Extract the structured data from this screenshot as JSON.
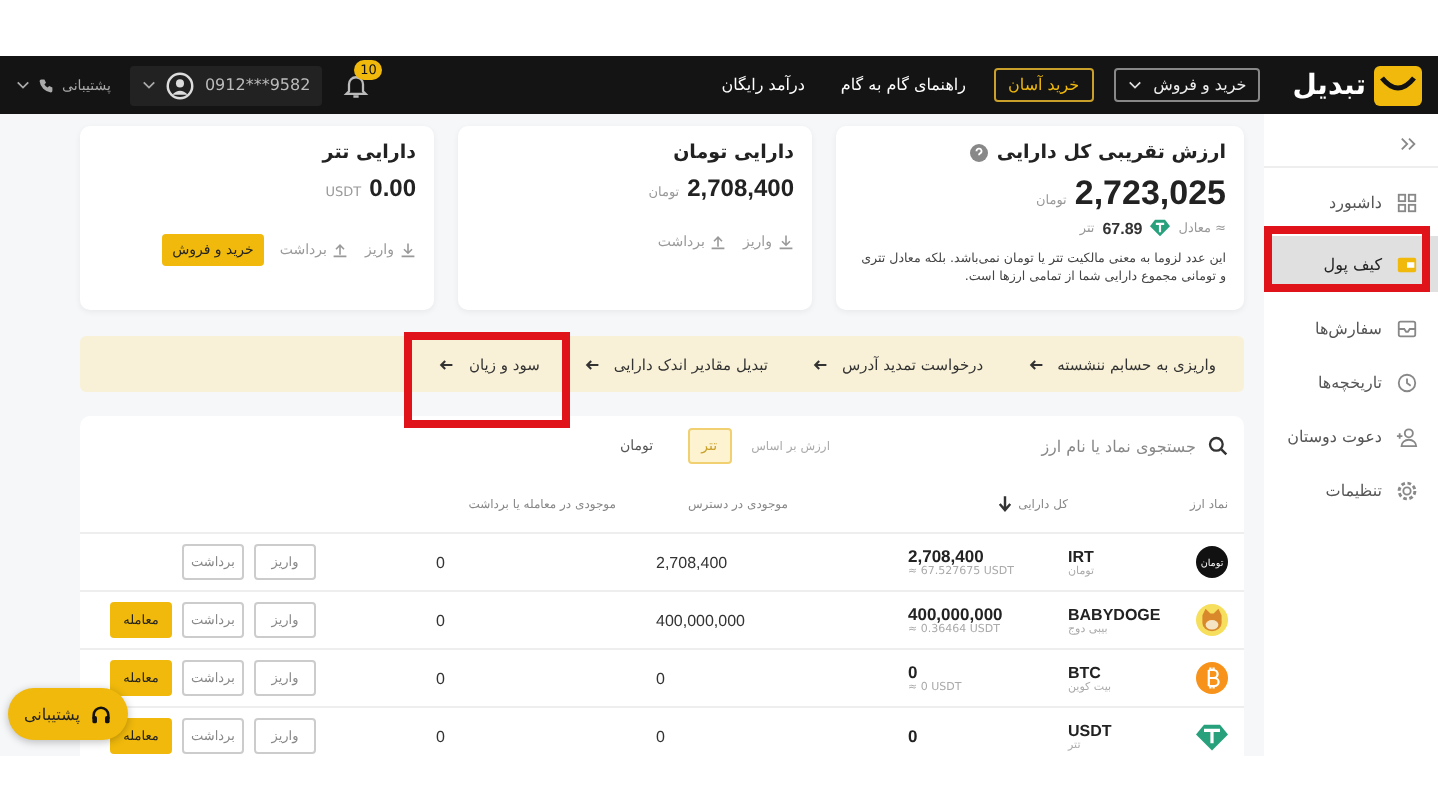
{
  "header": {
    "logo": "تبدیل",
    "nav": [
      {
        "label": "خرید و فروش",
        "kind": "dropdown"
      },
      {
        "label": "خرید آسان",
        "kind": "outlined"
      },
      {
        "label": "راهنمای گام به گام",
        "kind": "link"
      },
      {
        "label": "درآمد رایگان",
        "kind": "link"
      }
    ],
    "notifications": "10",
    "phone": "0912***9582",
    "support": "پشتیبانی"
  },
  "sidebar": {
    "items": [
      {
        "label": "داشبورد",
        "selected": false
      },
      {
        "label": "کیف پول",
        "selected": true
      },
      {
        "label": "سفارش‌ها",
        "selected": false
      },
      {
        "label": "تاریخچه‌ها",
        "selected": false
      },
      {
        "label": "دعوت دوستان",
        "selected": false
      },
      {
        "label": "تنظیمات",
        "selected": false
      }
    ]
  },
  "total_card": {
    "title": "ارزش تقریبی کل دارایی",
    "value": "2,723,025",
    "unit": "تومان",
    "approx_label": "≈ معادل",
    "approx_value": "67.89",
    "approx_unit": "تتر",
    "note": "این عدد لزوما به معنی مالکیت تتر یا تومان نمی‌باشد. بلکه معادل تتری و تومانی مجموع دارایی شما از تمامی ارزها است."
  },
  "balance_cards": [
    {
      "title": "دارایی تومان",
      "value": "2,708,400",
      "unit": "تومان",
      "actions": [
        {
          "label": "واریز",
          "kind": "deposit"
        },
        {
          "label": "برداشت",
          "kind": "withdraw"
        }
      ]
    },
    {
      "title": "دارایی تتر",
      "value": "0.00",
      "unit": "USDT",
      "actions": [
        {
          "label": "واریز",
          "kind": "deposit"
        },
        {
          "label": "برداشت",
          "kind": "withdraw"
        },
        {
          "label": "خرید و فروش",
          "kind": "trade"
        }
      ]
    }
  ],
  "quick_links": [
    "واریزی به حسابم ننشسته",
    "درخواست تمدید آدرس",
    "تبدیل مقادیر اندک دارایی",
    "سود و زیان"
  ],
  "table": {
    "search": {
      "placeholder": "جستجوی نماد یا نام ارز"
    },
    "value_label": "ارزش بر اساس",
    "currency_toggle": [
      {
        "label": "تتر",
        "selected": true
      },
      {
        "label": "تومان",
        "selected": false
      }
    ],
    "columns": [
      "نماد ارز",
      "کل دارایی",
      "موجودی در دسترس",
      "موجودی در معامله یا برداشت"
    ],
    "rows": [
      {
        "symbol": "IRT",
        "name": "تومان",
        "icon_text": "تومان",
        "total": "2,708,400",
        "approx": "≈ 67.527675 USDT",
        "available": "2,708,400",
        "in_trade": "0",
        "actions": [
          {
            "label": "واریز",
            "kind": "deposit"
          },
          {
            "label": "برداشت",
            "kind": "withdraw"
          }
        ]
      },
      {
        "symbol": "BABYDOGE",
        "name": "بیبی دوج",
        "total": "400,000,000",
        "approx": "≈ 0.36464 USDT",
        "available": "400,000,000",
        "in_trade": "0",
        "actions": [
          {
            "label": "واریز",
            "kind": "deposit"
          },
          {
            "label": "برداشت",
            "kind": "withdraw"
          },
          {
            "label": "معامله",
            "kind": "trade"
          }
        ]
      },
      {
        "symbol": "BTC",
        "name": "بیت کوین",
        "total": "0",
        "approx": "≈ 0 USDT",
        "available": "0",
        "in_trade": "0",
        "actions": [
          {
            "label": "واریز",
            "kind": "deposit"
          },
          {
            "label": "برداشت",
            "kind": "withdraw"
          },
          {
            "label": "معامله",
            "kind": "trade"
          }
        ]
      },
      {
        "symbol": "USDT",
        "name": "تتر",
        "total": "0",
        "available": "0",
        "in_trade": "0",
        "actions": [
          {
            "label": "واریز",
            "kind": "deposit"
          },
          {
            "label": "برداشت",
            "kind": "withdraw"
          },
          {
            "label": "معامله",
            "kind": "trade"
          }
        ]
      }
    ]
  },
  "support_button": "پشتیبانی"
}
